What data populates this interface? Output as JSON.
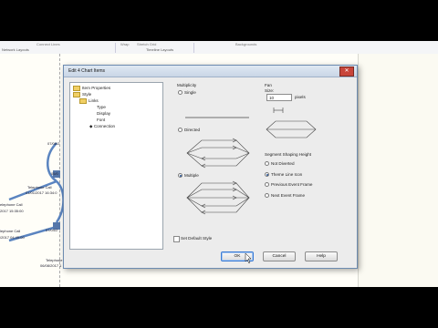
{
  "ribbon": {
    "items": [
      "Connect Lines",
      "Wrap",
      "Stretch Grid",
      "Backgrounds"
    ],
    "groups": [
      "Network Layouts",
      "Timeline Layouts"
    ]
  },
  "canvas": {
    "nodes": [
      {
        "label": "07/08/2"
      },
      {
        "label": "05/0"
      },
      {
        "label": "Telephone Call"
      },
      {
        "label": "01/01/2017 16:34:0"
      },
      {
        "label": "elephone Call"
      },
      {
        "label": "2017 15:35:00"
      },
      {
        "label": "07/04/2"
      },
      {
        "label": "lephone Call"
      },
      {
        "label": "/2017 04:45:00"
      },
      {
        "label": "Telephone"
      },
      {
        "label": "06/08/2017 1"
      }
    ]
  },
  "dialog": {
    "title": "Edit 4 Chart Items",
    "close": "✕",
    "tree": {
      "items": [
        {
          "label": "Item Properties"
        },
        {
          "label": "Style"
        },
        {
          "label": "Links"
        },
        {
          "label": "Type"
        },
        {
          "label": "Display"
        },
        {
          "label": "Font"
        },
        {
          "label": "Connection"
        }
      ]
    },
    "multiplicity": {
      "label": "Multiplicity",
      "options": [
        "Single",
        "Directed",
        "Multiple"
      ]
    },
    "fan": {
      "label": "Fan",
      "size_label": "Size:",
      "size_value": "10",
      "unit": "pixels"
    },
    "segment": {
      "label": "Segment Shaping Height",
      "options": [
        "Not Diverted",
        "Theme Line Icon",
        "Previous Event Frame",
        "Next Event Frame"
      ]
    },
    "set_default": "Set Default Style",
    "buttons": {
      "ok": "OK",
      "cancel": "Cancel",
      "help": "Help"
    }
  }
}
